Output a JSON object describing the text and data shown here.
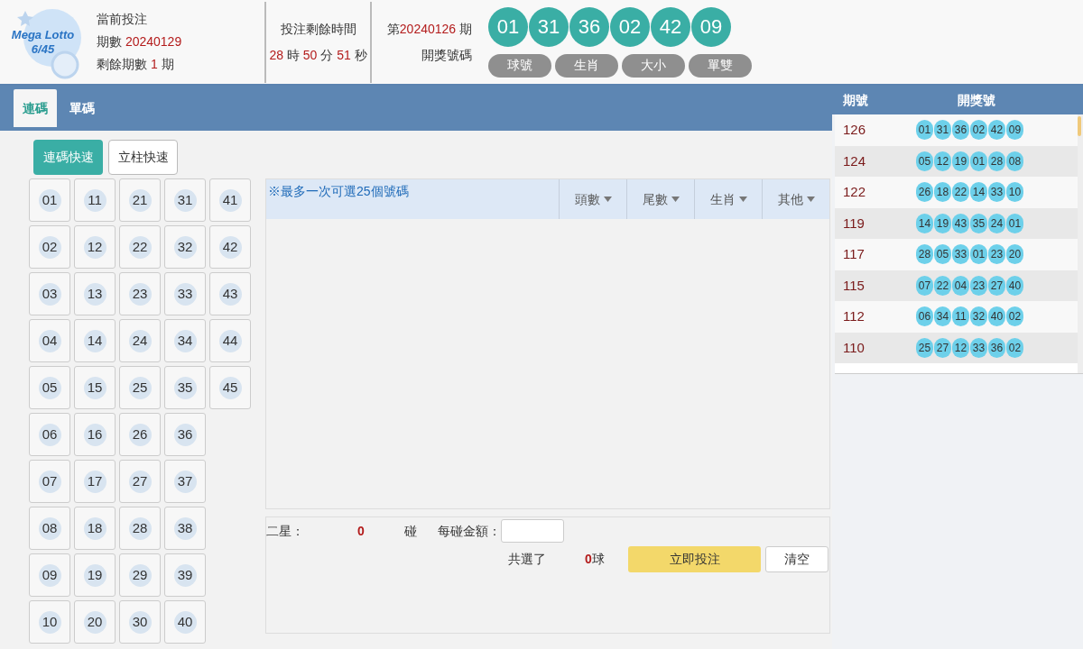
{
  "logo": {
    "lines": [
      "Mega Lotto",
      "6/45"
    ]
  },
  "current": {
    "title": "當前投注",
    "period_label": "期數",
    "period": "20240129",
    "remaining_label": "剩餘期數",
    "remaining": "1",
    "remaining_unit": "期"
  },
  "timer": {
    "title": "投注剩餘時間",
    "parts": [
      {
        "value": "28",
        "unit": "時"
      },
      {
        "value": "50",
        "unit": "分"
      },
      {
        "value": "51",
        "unit": "秒"
      }
    ]
  },
  "last_draw": {
    "prefix": "第",
    "period": "20240126",
    "suffix": "期",
    "label": "開獎號碼",
    "balls": [
      "01",
      "31",
      "36",
      "02",
      "42",
      "09"
    ],
    "buttons": [
      "球號",
      "生肖",
      "大小",
      "單雙"
    ]
  },
  "tabs": [
    {
      "label": "連碼",
      "selected": true
    },
    {
      "label": "單碼",
      "selected": false
    }
  ],
  "modes": [
    {
      "label": "連碼快速",
      "selected": true
    },
    {
      "label": "立柱快速",
      "selected": false
    }
  ],
  "number_columns": [
    [
      "01",
      "02",
      "03",
      "04",
      "05",
      "06",
      "07",
      "08",
      "09",
      "10"
    ],
    [
      "11",
      "12",
      "13",
      "14",
      "15",
      "16",
      "17",
      "18",
      "19",
      "20"
    ],
    [
      "21",
      "22",
      "23",
      "24",
      "25",
      "26",
      "27",
      "28",
      "29",
      "30"
    ],
    [
      "31",
      "32",
      "33",
      "34",
      "35",
      "36",
      "37",
      "38",
      "39",
      "40"
    ],
    [
      "41",
      "42",
      "43",
      "44",
      "45"
    ]
  ],
  "selection": {
    "note": "※最多一次可選25個號碼",
    "filters": [
      "頭數",
      "尾數",
      "生肖",
      "其他"
    ]
  },
  "summary": {
    "type_label": "二星：",
    "count": "0",
    "count_unit": "碰",
    "amount_label": "每碰金額：",
    "total_label": "共選了",
    "total": "0",
    "total_unit": "球",
    "submit": "立即投注",
    "clear": "清空"
  },
  "history": {
    "columns": [
      "期號",
      "開獎號"
    ],
    "rows": [
      {
        "period": "126",
        "balls": [
          "01",
          "31",
          "36",
          "02",
          "42",
          "09"
        ]
      },
      {
        "period": "124",
        "balls": [
          "05",
          "12",
          "19",
          "01",
          "28",
          "08"
        ]
      },
      {
        "period": "122",
        "balls": [
          "26",
          "18",
          "22",
          "14",
          "33",
          "10"
        ]
      },
      {
        "period": "119",
        "balls": [
          "14",
          "19",
          "43",
          "35",
          "24",
          "01"
        ]
      },
      {
        "period": "117",
        "balls": [
          "28",
          "05",
          "33",
          "01",
          "23",
          "20"
        ]
      },
      {
        "period": "115",
        "balls": [
          "07",
          "22",
          "04",
          "23",
          "27",
          "40"
        ]
      },
      {
        "period": "112",
        "balls": [
          "06",
          "34",
          "11",
          "32",
          "40",
          "02"
        ]
      },
      {
        "period": "110",
        "balls": [
          "25",
          "27",
          "12",
          "33",
          "36",
          "02"
        ]
      }
    ]
  }
}
